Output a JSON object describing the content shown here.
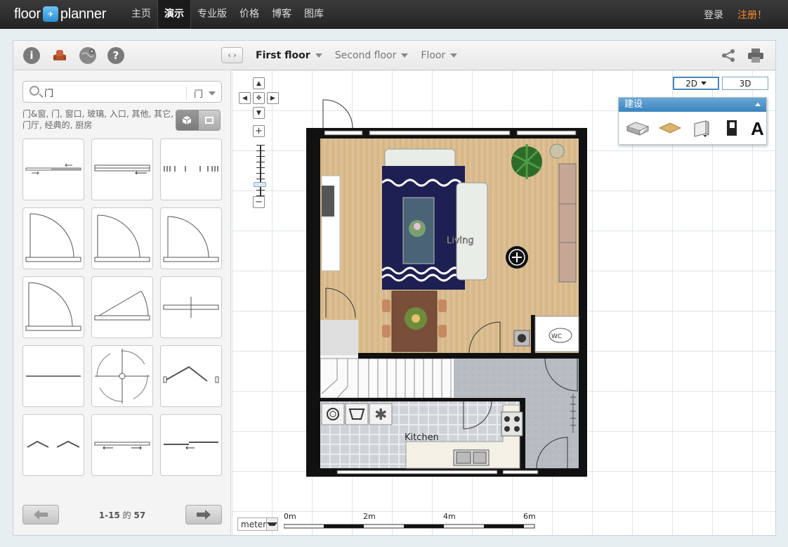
{
  "brand": {
    "name_left": "floor",
    "name_right": "planner"
  },
  "nav": {
    "items": [
      {
        "label": "主页",
        "active": false
      },
      {
        "label": "演示",
        "active": true
      },
      {
        "label": "专业版",
        "active": false
      },
      {
        "label": "价格",
        "active": false
      },
      {
        "label": "博客",
        "active": false
      },
      {
        "label": "图库",
        "active": false
      }
    ],
    "login": "登录",
    "register": "注册！"
  },
  "toolbar": {
    "icons": [
      "info-icon",
      "furniture-chair-icon",
      "globe-settings-icon",
      "help-icon"
    ],
    "floors": [
      {
        "label": "First floor",
        "active": true
      },
      {
        "label": "Second floor",
        "active": false
      },
      {
        "label": "Floor",
        "active": false
      }
    ]
  },
  "sidebar": {
    "search": {
      "value": "门",
      "category": "门"
    },
    "filter_text": "门&窗, 门, 窗口, 玻璃, 入口, 其他, 其它, 门厅, 经典的, 厨房",
    "pager": {
      "range": "1-15",
      "of": "的",
      "total": "57"
    }
  },
  "canvas": {
    "view_modes": [
      {
        "label": "2D",
        "active": true
      },
      {
        "label": "3D",
        "active": false
      }
    ],
    "build_panel": {
      "title": "建设"
    },
    "rooms": {
      "living": "Living",
      "kitchen": "Kitchen",
      "wc": "WC"
    },
    "units": "meter",
    "scale_labels": [
      "0m",
      "2m",
      "4m",
      "6m"
    ]
  },
  "colors": {
    "accent": "#ff8c2b",
    "build_header": "#4a90c8",
    "wall": "#111111",
    "rug": "#1e1f52",
    "wood_floor": "#d6b88c"
  }
}
